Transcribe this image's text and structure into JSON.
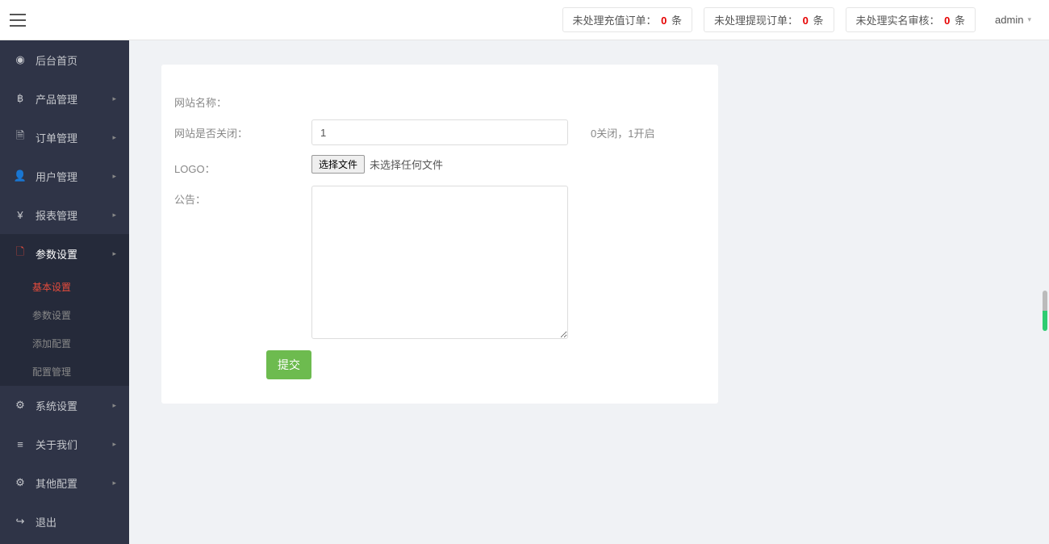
{
  "header": {
    "recharge": {
      "label": "未处理充值订单：",
      "value": "0",
      "unit": "条"
    },
    "withdraw": {
      "label": "未处理提现订单：",
      "value": "0",
      "unit": "条"
    },
    "realname": {
      "label": "未处理实名审核：",
      "value": "0",
      "unit": "条"
    },
    "admin_label": "admin"
  },
  "sidebar": {
    "items": [
      {
        "icon": "◉",
        "label": "后台首页",
        "has_arrow": false
      },
      {
        "icon": "฿",
        "label": "产品管理",
        "has_arrow": true
      },
      {
        "icon": "🗎",
        "label": "订单管理",
        "has_arrow": true
      },
      {
        "icon": "👤",
        "label": "用户管理",
        "has_arrow": true
      },
      {
        "icon": "¥",
        "label": "报表管理",
        "has_arrow": true
      },
      {
        "icon": "🗋",
        "label": "参数设置",
        "has_arrow": true,
        "active": true,
        "submenu": [
          {
            "label": "基本设置",
            "active": true
          },
          {
            "label": "参数设置"
          },
          {
            "label": "添加配置"
          },
          {
            "label": "配置管理"
          }
        ]
      },
      {
        "icon": "⚙",
        "label": "系统设置",
        "has_arrow": true
      },
      {
        "icon": "≡",
        "label": "关于我们",
        "has_arrow": true
      },
      {
        "icon": "⚙",
        "label": "其他配置",
        "has_arrow": true
      },
      {
        "icon": "↪",
        "label": "退出",
        "has_arrow": false
      }
    ]
  },
  "form": {
    "site_name": {
      "label": "网站名称：",
      "value": ""
    },
    "site_closed": {
      "label": "网站是否关闭：",
      "value": "1",
      "hint": "0关闭，1开启"
    },
    "logo": {
      "label": "LOGO：",
      "file_btn": "选择文件",
      "file_status": "未选择任何文件"
    },
    "notice": {
      "label": "公告：",
      "value": ""
    },
    "submit": "提交"
  }
}
